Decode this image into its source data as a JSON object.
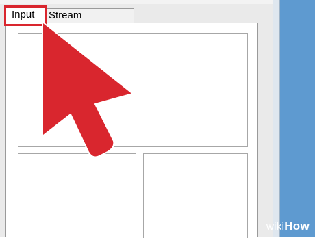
{
  "tabs": [
    {
      "label": "Input",
      "active": true
    },
    {
      "label": "Stream Processing",
      "active": false
    }
  ],
  "highlight_color": "#d9262e",
  "arrow_color": "#d9262e",
  "watermark": {
    "wiki": "wiki",
    "how": "How"
  }
}
